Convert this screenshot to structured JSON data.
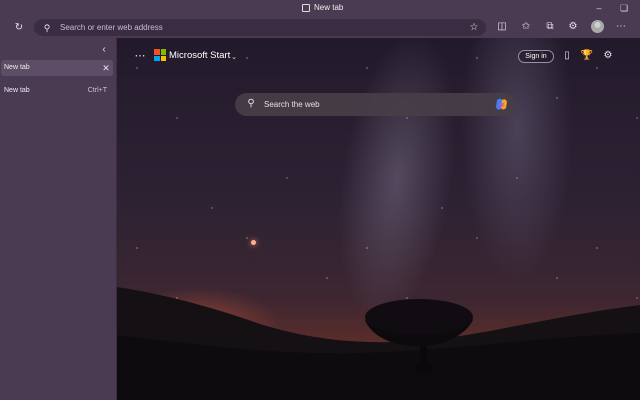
{
  "window": {
    "title": "New tab"
  },
  "address_bar": {
    "placeholder": "Search or enter web address"
  },
  "sidebar": {
    "tabs": [
      {
        "label": "New tab",
        "active": true
      },
      {
        "label": "New tab",
        "shortcut": "Ctrl+T"
      }
    ]
  },
  "newtab": {
    "brand": "Microsoft Start",
    "signin_label": "Sign in",
    "search_placeholder": "Search the web"
  },
  "colors": {
    "frame": "#4a3a52",
    "accent_logo": [
      "#f25022",
      "#7fba00",
      "#00a4ef",
      "#ffb900"
    ]
  },
  "icons": [
    "page-icon",
    "minimize-icon",
    "restore-icon",
    "refresh-icon",
    "search-icon",
    "star-icon",
    "split-screen-icon",
    "favorites-icon",
    "collections-icon",
    "extensions-icon",
    "avatar",
    "more-icon",
    "chevron-left-icon",
    "close-icon",
    "apps-grid-icon",
    "chevron-down-icon",
    "phone-icon",
    "rewards-icon",
    "settings-icon",
    "copilot-icon"
  ]
}
